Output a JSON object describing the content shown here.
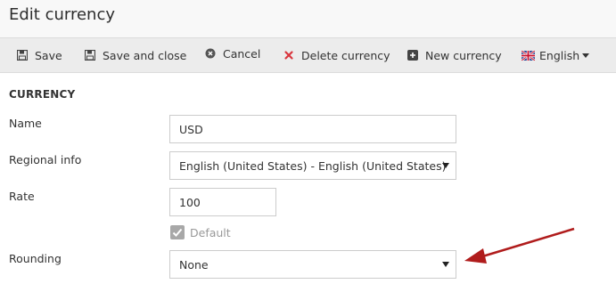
{
  "page": {
    "title": "Edit currency"
  },
  "toolbar": {
    "save": {
      "label": "Save",
      "icon": "save-icon"
    },
    "save_close": {
      "label": "Save and close",
      "icon": "save-icon"
    },
    "cancel": {
      "label": "Cancel",
      "icon": "cancel-icon"
    },
    "delete": {
      "label": "Delete currency",
      "icon": "delete-icon",
      "icon_color": "#d9363e"
    },
    "new_currency": {
      "label": "New currency",
      "icon": "plus-icon"
    },
    "language": {
      "label": "English",
      "icon": "uk-flag-icon"
    }
  },
  "form": {
    "section_title": "CURRENCY",
    "name": {
      "label": "Name",
      "value": "USD"
    },
    "regional_info": {
      "label": "Regional info",
      "value": "English (United States) - English (United States)"
    },
    "rate": {
      "label": "Rate",
      "value": "100"
    },
    "default": {
      "label": "Default",
      "checked": true
    },
    "rounding": {
      "label": "Rounding",
      "value": "None"
    }
  },
  "annotation": {
    "arrow_color": "#b01c1c"
  }
}
